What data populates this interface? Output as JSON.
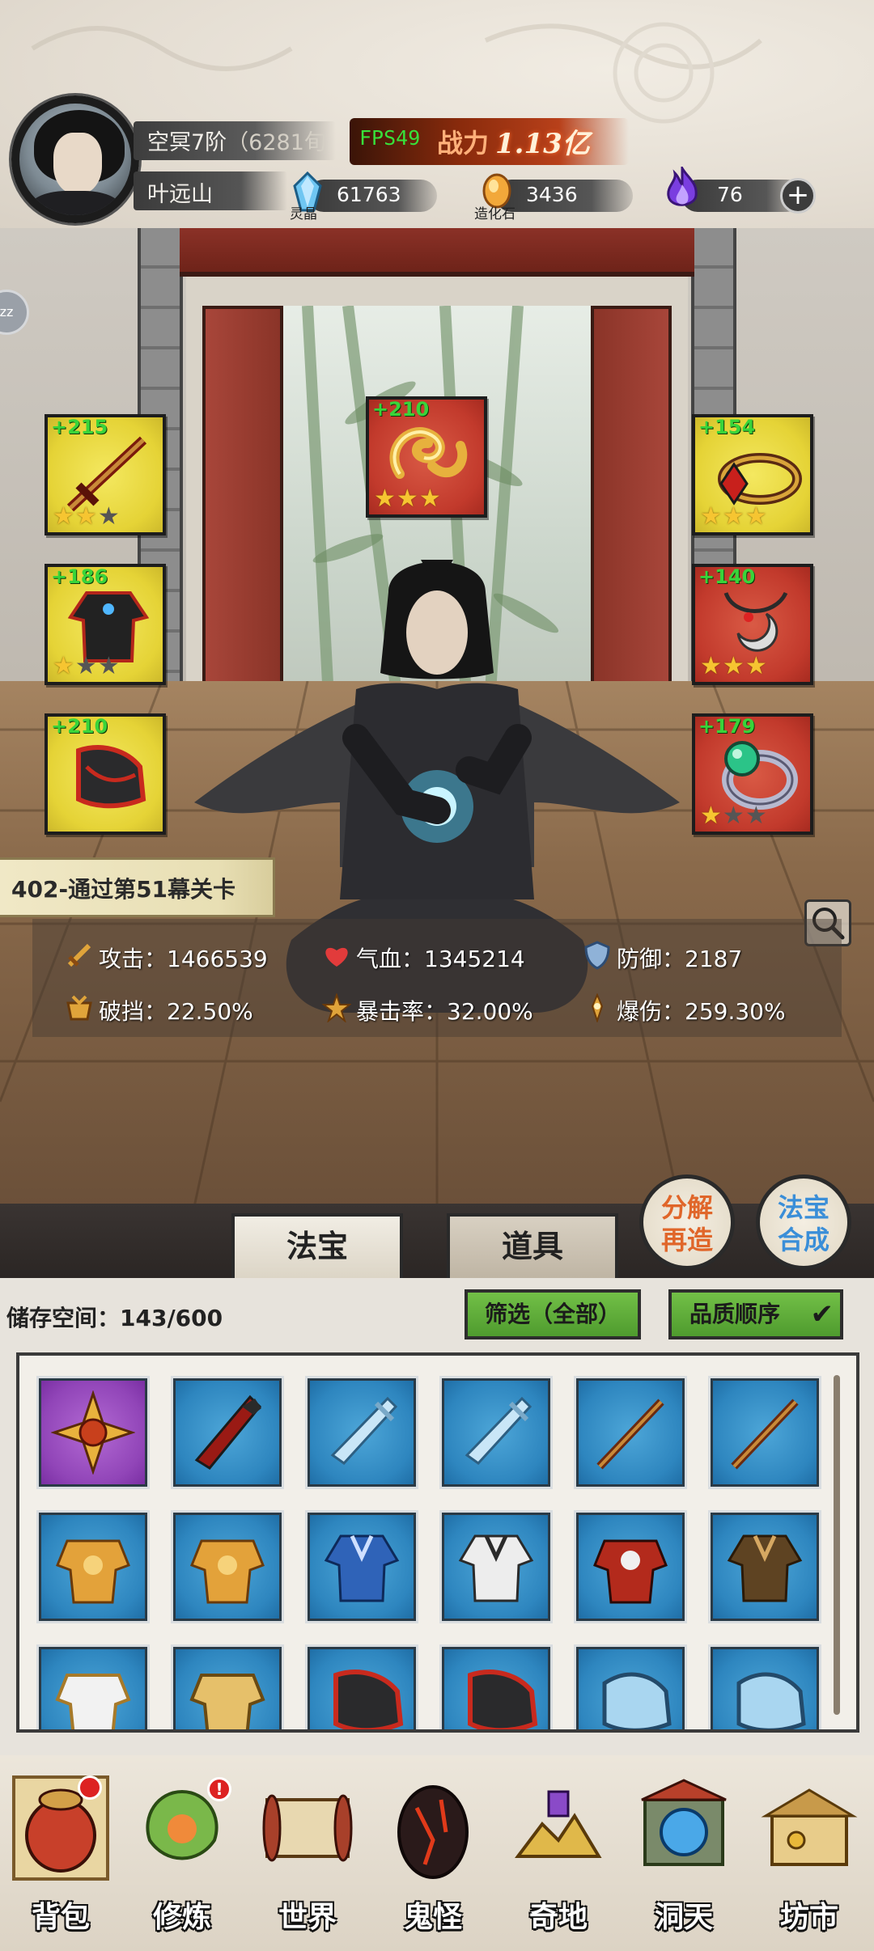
{
  "player": {
    "rank": "空冥7阶",
    "rank_detail": "（6281旬",
    "name": "叶远山",
    "fps": "FPS49",
    "power_label": "战力",
    "power_value": "1.13亿"
  },
  "resources": [
    {
      "icon": "spirit-crystal-icon",
      "value": "61763",
      "label": "灵晶"
    },
    {
      "icon": "creation-stone-icon",
      "value": "3436",
      "label": "造化石"
    },
    {
      "icon": "purple-flame-icon",
      "value": "76",
      "label": ""
    }
  ],
  "side_tab": {
    "label": "zz"
  },
  "equip_slots": [
    {
      "id": "sword",
      "bonus": "+215",
      "stars": 2,
      "color": "yellow"
    },
    {
      "id": "dragon",
      "bonus": "+210",
      "stars": 3,
      "color": "red"
    },
    {
      "id": "crown",
      "bonus": "+154",
      "stars": 3,
      "color": "yellow"
    },
    {
      "id": "armor",
      "bonus": "+186",
      "stars": 1,
      "color": "yellow"
    },
    {
      "id": "necklace",
      "bonus": "+140",
      "stars": 3,
      "color": "red"
    },
    {
      "id": "boots",
      "bonus": "+210",
      "stars": 0,
      "color": "yellow"
    },
    {
      "id": "ring",
      "bonus": "+179",
      "stars": 1,
      "color": "red"
    }
  ],
  "stage": {
    "label": "402-通过第51幕关卡"
  },
  "stats": {
    "attack": "攻击：1466539",
    "hp": "气血：1345214",
    "defense": "防御：2187",
    "break": "破挡：22.50%",
    "crit_rate": "暴击率：32.00%",
    "crit_dmg": "爆伤：259.30%"
  },
  "tabs": {
    "treasure": "法宝",
    "items": "道具"
  },
  "round_buttons": {
    "decompose_line1": "分解",
    "decompose_line2": "再造",
    "compose_line1": "法宝",
    "compose_line2": "合成"
  },
  "inventory": {
    "storage": "储存空间：143/600",
    "filter": "筛选（全部）",
    "sort": "品质顺序"
  },
  "nav": [
    {
      "label": "背包",
      "icon": "backpack-icon",
      "badge": ""
    },
    {
      "label": "修炼",
      "icon": "cultivate-icon",
      "badge": "!"
    },
    {
      "label": "世界",
      "icon": "world-scroll-icon",
      "badge": ""
    },
    {
      "label": "鬼怪",
      "icon": "ghost-egg-icon",
      "badge": ""
    },
    {
      "label": "奇地",
      "icon": "strange-land-icon",
      "badge": ""
    },
    {
      "label": "洞天",
      "icon": "cave-portal-icon",
      "badge": ""
    },
    {
      "label": "坊市",
      "icon": "market-icon",
      "badge": ""
    }
  ],
  "colors": {
    "slot_yellow": "#e5d336",
    "slot_red": "#c23a2c",
    "cell_blue": "#2e86bf",
    "cell_purple": "#9145b8",
    "bonus_green": "#39d43a",
    "filter_green": "#5fae38"
  }
}
